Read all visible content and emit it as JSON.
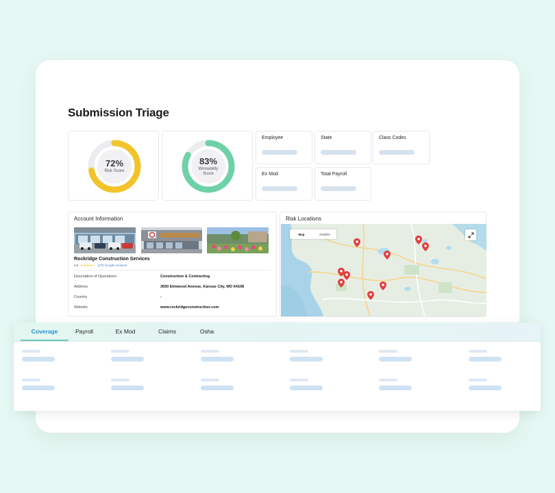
{
  "page": {
    "title": "Submission Triage"
  },
  "scores": [
    {
      "value": "72%",
      "label": "Risk Score",
      "fraction": 0.72,
      "color": "#f2c42a"
    },
    {
      "value": "83%",
      "label": "Winnability Score",
      "fraction": 0.83,
      "color": "#6fd1a8"
    }
  ],
  "stats": {
    "employee": "Employee",
    "state": "State",
    "class_codes": "Class Codes",
    "ex_mod": "Ex Mod",
    "total_payroll": "Total Payroll"
  },
  "account": {
    "title": "Account Information",
    "company": "Rockridge Construction Services",
    "rating": "4.0",
    "stars": "★★★★☆",
    "reviews": "(276 Google reviews)",
    "rows": [
      {
        "key": "Description of Operations",
        "value": "Construction & Contracting"
      },
      {
        "key": "Address",
        "value": "3650 Elmwood Avenue, Kansas City, MO 64108"
      },
      {
        "key": "Country",
        "value": "-"
      },
      {
        "key": "Website",
        "value": "www.rockridgeconstruction.com"
      }
    ]
  },
  "risk_locations": {
    "title": "Risk Locations",
    "map_tab": "Map",
    "satellite_tab": "Satellite"
  },
  "tabs": [
    "Coverage",
    "Payroll",
    "Ex Mod",
    "Claims",
    "Osha"
  ],
  "colors": {
    "background": "#e6f8f3",
    "active_tab": "#2a8fd0",
    "risk_gauge": "#f2c42a",
    "winnability_gauge": "#6fd1a8",
    "map_pin": "#e2403f"
  }
}
